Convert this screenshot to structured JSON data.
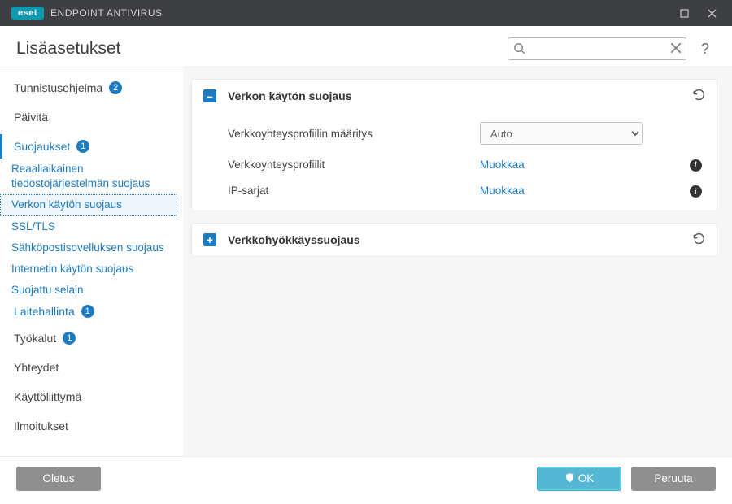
{
  "titlebar": {
    "brand": "eset",
    "product": "ENDPOINT ANTIVIRUS"
  },
  "header": {
    "title": "Lisäasetukset",
    "search_value": "",
    "search_placeholder": ""
  },
  "sidebar": {
    "items": [
      {
        "label": "Tunnistusohjelma",
        "badge": "2",
        "type": "top"
      },
      {
        "label": "Päivitä",
        "type": "top-plain"
      },
      {
        "label": "Suojaukset",
        "badge": "1",
        "type": "top-active"
      },
      {
        "label": "Reaaliaikainen tiedostojärjestelmän suojaus",
        "type": "sub"
      },
      {
        "label": "Verkon käytön suojaus",
        "type": "sub-selected"
      },
      {
        "label": "SSL/TLS",
        "type": "sub"
      },
      {
        "label": "Sähköpostisovelluksen suojaus",
        "type": "sub"
      },
      {
        "label": "Internetin käytön suojaus",
        "type": "sub"
      },
      {
        "label": "Suojattu selain",
        "type": "sub"
      },
      {
        "label": "Laitehallinta",
        "badge": "1",
        "type": "sub-badge"
      },
      {
        "label": "Työkalut",
        "badge": "1",
        "type": "top-badge"
      },
      {
        "label": "Yhteydet",
        "type": "top-plain"
      },
      {
        "label": "Käyttöliittymä",
        "type": "top-plain"
      },
      {
        "label": "Ilmoitukset",
        "type": "top-plain"
      }
    ]
  },
  "panels": {
    "net_protection": {
      "title": "Verkon käytön suojaus",
      "expanded": true,
      "rows": {
        "profile_assign": {
          "label": "Verkkoyhteysprofiilin määritys",
          "value": "Auto"
        },
        "profiles": {
          "label": "Verkkoyhteysprofiilit",
          "action": "Muokkaa"
        },
        "ip_sets": {
          "label": "IP-sarjat",
          "action": "Muokkaa"
        }
      }
    },
    "attack_protection": {
      "title": "Verkkohyökkäyssuojaus",
      "expanded": false
    }
  },
  "footer": {
    "default": "Oletus",
    "ok": "OK",
    "cancel": "Peruuta"
  },
  "help_glyph": "?"
}
